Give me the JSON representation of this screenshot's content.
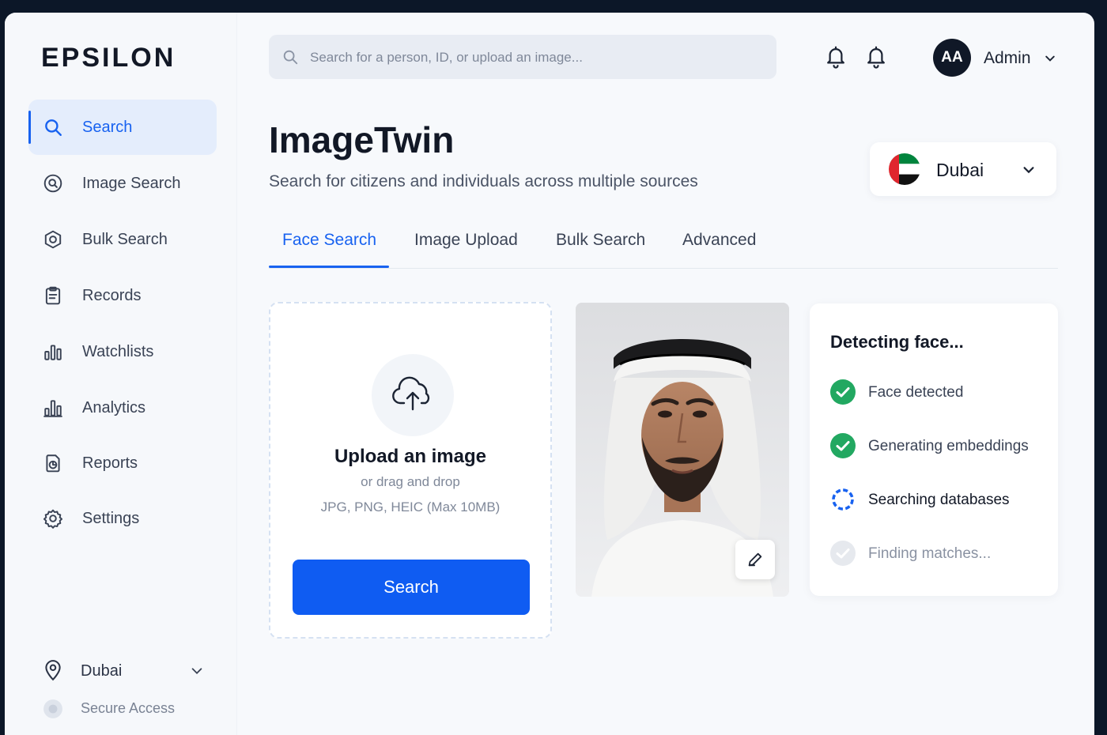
{
  "brand": {
    "name": "EPSILON"
  },
  "sidebar": {
    "items": [
      {
        "label": "Search",
        "icon": "search-icon",
        "active": true
      },
      {
        "label": "Image Search",
        "icon": "image-search-icon"
      },
      {
        "label": "Bulk Search",
        "icon": "bulk-search-icon"
      },
      {
        "label": "Records",
        "icon": "records-icon"
      },
      {
        "label": "Watchlists",
        "icon": "watchlists-icon"
      },
      {
        "label": "Analytics",
        "icon": "analytics-icon"
      },
      {
        "label": "Reports",
        "icon": "reports-icon"
      },
      {
        "label": "Settings",
        "icon": "gear-icon"
      }
    ],
    "location": {
      "label": "Dubai",
      "icon": "map-pin-icon"
    },
    "secure": {
      "label": "Secure Access",
      "icon": "shield-icon"
    }
  },
  "topbar": {
    "search_placeholder": "Search for a person, ID, or upload an image...",
    "user": {
      "initials": "AA",
      "name": "Admin"
    }
  },
  "page": {
    "title": "ImageTwin",
    "subtitle": "Search for citizens and individuals across multiple sources",
    "region": {
      "label": "Dubai",
      "flag": "uae-flag-icon"
    }
  },
  "tabs": [
    {
      "label": "Face Search",
      "active": true
    },
    {
      "label": "Image Upload"
    },
    {
      "label": "Bulk Search"
    },
    {
      "label": "Advanced"
    }
  ],
  "upload": {
    "title": "Upload an image",
    "hint": "or drag and drop",
    "formats": "JPG, PNG, HEIC (Max 10MB)",
    "button_label": "Search"
  },
  "status": {
    "title": "Detecting face...",
    "steps": [
      {
        "label": "Face detected",
        "state": "done"
      },
      {
        "label": "Generating embeddings",
        "state": "done"
      },
      {
        "label": "Searching databases",
        "state": "in-progress"
      },
      {
        "label": "Finding matches...",
        "state": "pending"
      }
    ]
  },
  "colors": {
    "accent": "#1862f0",
    "success": "#22a861",
    "sidebar_bg": "#f6f8fb",
    "frame_bg": "#0c1728"
  }
}
